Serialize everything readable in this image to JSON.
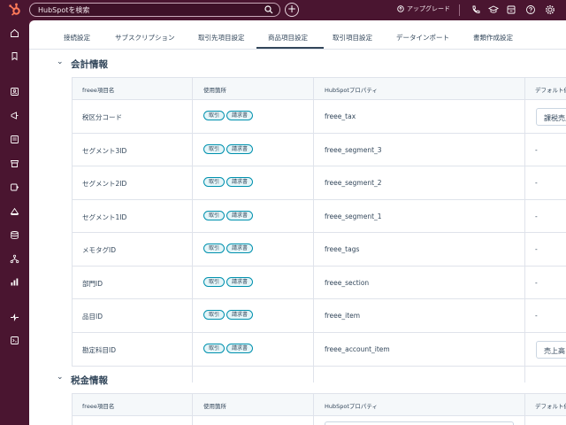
{
  "topbar": {
    "search_placeholder": "HubSpotを検索",
    "upgrade_label": "アップグレード"
  },
  "tabs": [
    {
      "label": "接続設定"
    },
    {
      "label": "サブスクリプション"
    },
    {
      "label": "取引先項目設定"
    },
    {
      "label": "商品項目設定"
    },
    {
      "label": "取引項目設定"
    },
    {
      "label": "データインポート"
    },
    {
      "label": "書類作成設定"
    }
  ],
  "active_tab": "商品項目設定",
  "sections": [
    {
      "title": "会計情報",
      "columns": [
        "freee項目名",
        "使用箇所",
        "HubSpotプロパティ",
        "デフォルト値"
      ],
      "rows": [
        {
          "name": "税区分コード",
          "tags": [
            "取引",
            "請求書"
          ],
          "property": "freee_tax",
          "default": "課税売上"
        },
        {
          "name": "セグメント3ID",
          "tags": [
            "取引",
            "請求書"
          ],
          "property": "freee_segment_3",
          "default": "-"
        },
        {
          "name": "セグメント2ID",
          "tags": [
            "取引",
            "請求書"
          ],
          "property": "freee_segment_2",
          "default": "-"
        },
        {
          "name": "セグメント1ID",
          "tags": [
            "取引",
            "請求書"
          ],
          "property": "freee_segment_1",
          "default": "-"
        },
        {
          "name": "メモタグID",
          "tags": [
            "取引",
            "請求書"
          ],
          "property": "freee_tags",
          "default": "-"
        },
        {
          "name": "部門ID",
          "tags": [
            "取引",
            "請求書"
          ],
          "property": "freee_section",
          "default": "-"
        },
        {
          "name": "品目ID",
          "tags": [
            "取引",
            "請求書"
          ],
          "property": "freee_item",
          "default": "-"
        },
        {
          "name": "勘定科目ID",
          "tags": [
            "取引",
            "請求書"
          ],
          "property": "freee_account_item",
          "default": "売上高"
        }
      ]
    },
    {
      "title": "税金情報",
      "columns": [
        "freee項目名",
        "使用箇所",
        "HubSpotプロパティ",
        "デフォルト値"
      ]
    }
  ],
  "colors": {
    "chrome": "#4a1530",
    "tag_border": "#0091ae",
    "text": "#33475b"
  }
}
